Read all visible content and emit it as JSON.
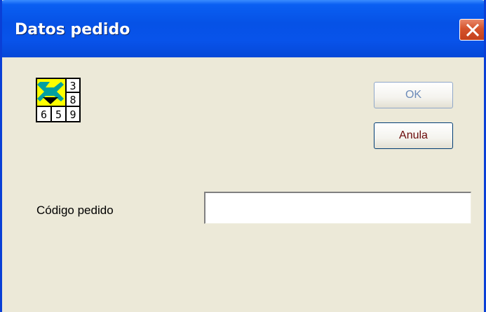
{
  "window": {
    "title": "Datos pedido"
  },
  "app_icon": {
    "name": "grid-numbers-icon",
    "digits_right": [
      "3",
      "8"
    ],
    "digits_bottom": [
      "6",
      "5",
      "9"
    ]
  },
  "buttons": {
    "ok_label": "OK",
    "cancel_label": "Anula"
  },
  "form": {
    "order_code_label": "Código pedido",
    "order_code_value": ""
  },
  "colors": {
    "titlebar": "#0652E6",
    "background": "#ECE9D8",
    "close_button": "#D5532C",
    "cancel_text": "#6B0A0A",
    "ok_text": "#6D8BB9"
  }
}
